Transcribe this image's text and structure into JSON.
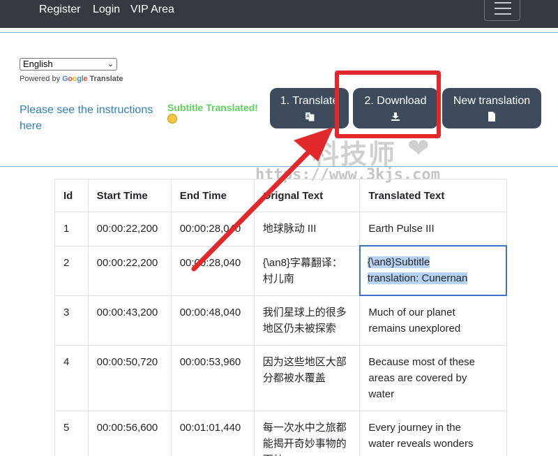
{
  "nav": {
    "links": [
      "Register",
      "Login",
      "VIP Area"
    ]
  },
  "language_select": {
    "selected": "English"
  },
  "powered_by": {
    "prefix": "Powered by",
    "google": "Google",
    "translate": "Translate"
  },
  "instructions": {
    "text": "Please see the instructions here"
  },
  "status": {
    "text": "Subtitle Translated!"
  },
  "buttons": {
    "translate": "1. Translate",
    "download": "2. Download",
    "new_translation": "New translation"
  },
  "watermark": {
    "cn": "科技师",
    "url": "https://www.3kjs.com"
  },
  "table": {
    "headers": [
      "Id",
      "Start Time",
      "End Time",
      "Orignal Text",
      "Translated Text"
    ],
    "rows": [
      {
        "id": "1",
        "start": "00:00:22,200",
        "end": "00:00:28,040",
        "original": "地球脉动 III",
        "translated_lines": [
          "Earth Pulse III"
        ]
      },
      {
        "id": "2",
        "start": "00:00:22,200",
        "end": "00:00:28,040",
        "original": "{\\an8}字幕翻译：村儿南",
        "translated_lines": [
          "{\\an8}Subtitle",
          "translation: Cunernan"
        ]
      },
      {
        "id": "3",
        "start": "00:00:43,200",
        "end": "00:00:48,040",
        "original": "我们星球上的很多地区仍未被探索",
        "translated_lines": [
          "Much of our planet",
          "remains unexplored"
        ]
      },
      {
        "id": "4",
        "start": "00:00:50,720",
        "end": "00:00:53,960",
        "original": "因为这些地区大部分都被水覆盖",
        "translated_lines": [
          "Because most of these",
          "areas are covered by",
          "water"
        ]
      },
      {
        "id": "5",
        "start": "00:00:56,600",
        "end": "00:01:01,440",
        "original": "每一次水中之旅都能揭开奇妙事物的面纱",
        "translated_lines": [
          "Every journey in the",
          "water reveals wonders"
        ]
      }
    ]
  },
  "colors": {
    "navbar": "#343a40",
    "button": "#3d4a5c",
    "link": "#2f7fc1",
    "status": "#5ed15e",
    "annotation": "#e2282b"
  }
}
